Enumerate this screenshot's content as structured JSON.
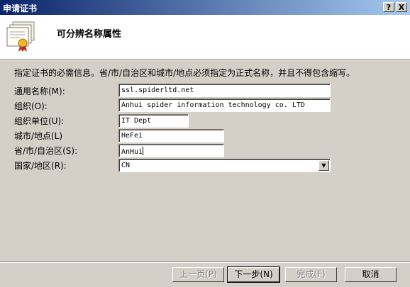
{
  "window": {
    "title": "申请证书",
    "help_button": "?",
    "close_button": "X"
  },
  "header": {
    "title": "可分辨名称属性",
    "icon": "certificate-icon"
  },
  "instruction": "指定证书的必需信息。省/市/自治区和城市/地点必须指定为正式名称，并且不得包含缩写。",
  "form": {
    "common_name": {
      "label": "通用名称(M):",
      "value": "ssl.spiderltd.net"
    },
    "organization": {
      "label": "组织(O):",
      "value": "Anhui spider information technology co. LTD"
    },
    "organizational_unit": {
      "label": "组织单位(U):",
      "value": "IT Dept"
    },
    "city": {
      "label": "城市/地点(L)",
      "value": "HeFei"
    },
    "state": {
      "label": "省/市/自治区(S):",
      "value": "AnHui"
    },
    "country": {
      "label": "国家/地区(R):",
      "value": "CN"
    }
  },
  "buttons": {
    "previous": "上一页(P)",
    "next": "下一步(N)",
    "finish": "完成(F)",
    "cancel": "取消"
  }
}
